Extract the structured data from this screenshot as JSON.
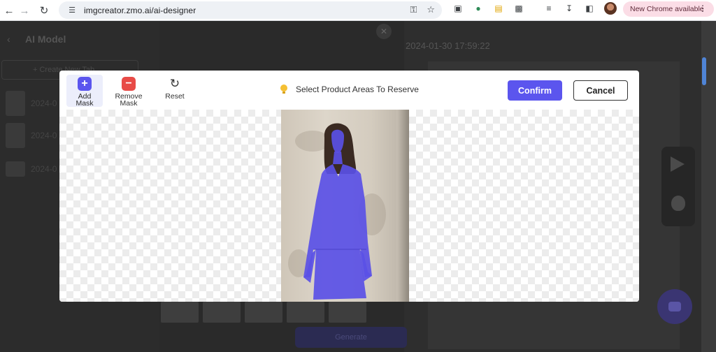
{
  "browser": {
    "url": "imgcreator.zmo.ai/ai-designer",
    "update_label": "New Chrome available"
  },
  "background": {
    "page_title": "AI Model",
    "create_label": "+ Create New Tab",
    "history_labels": [
      "2024-0",
      "2024-0",
      "2024-0"
    ],
    "date_label": "2024-01-30 17:59:22",
    "generate_label": "Generate"
  },
  "modal": {
    "tools": {
      "add_line1": "Add",
      "add_line2": "Mask",
      "remove_line1": "Remove",
      "remove_line2": "Mask",
      "reset": "Reset"
    },
    "hint": "Select Product Areas To Reserve",
    "confirm_label": "Confirm",
    "cancel_label": "Cancel"
  },
  "colors": {
    "accent": "#5b55ee",
    "remove": "#e84b47",
    "mask": "#5a50e6"
  }
}
